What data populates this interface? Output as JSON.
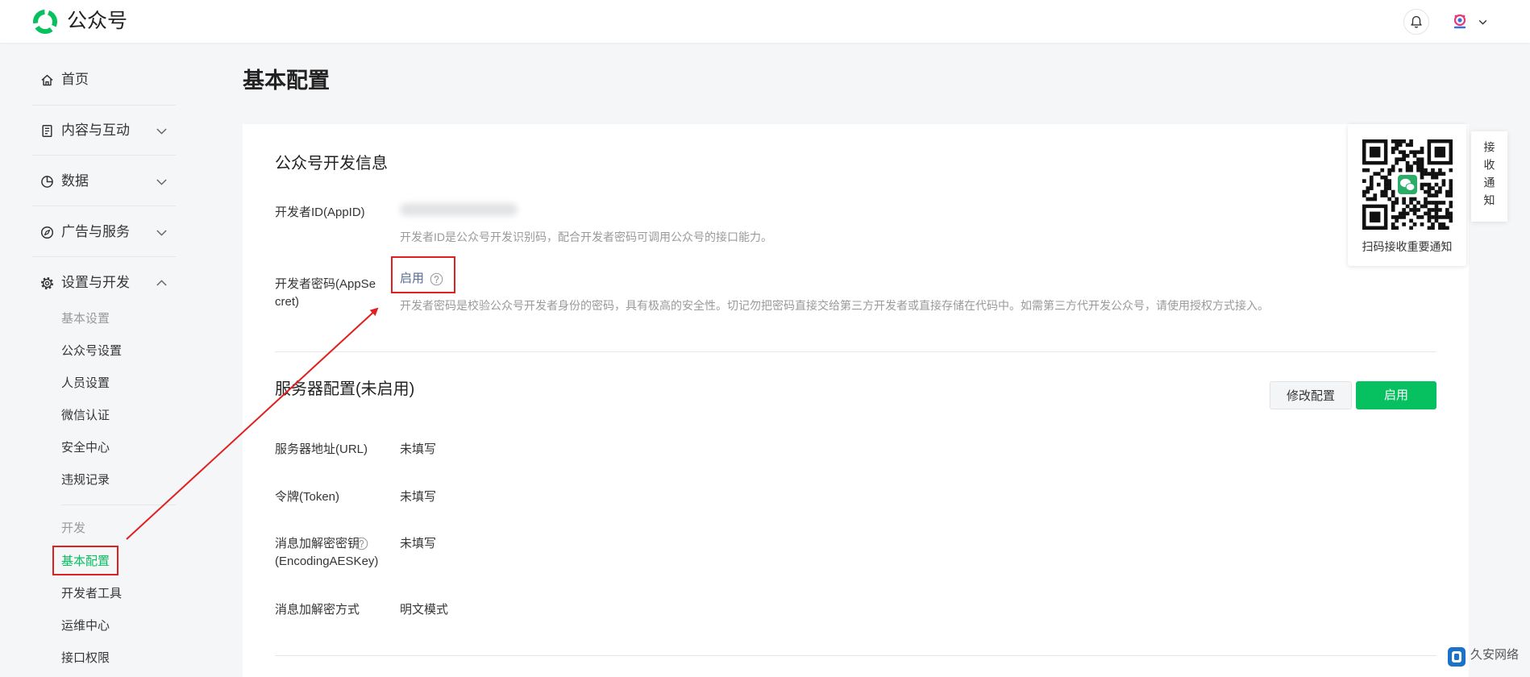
{
  "header": {
    "app_name": "公众号",
    "logo_icon": "wechat-official-account-logo-icon",
    "bell_icon": "bell-icon",
    "avatar_icon": "avatar",
    "menu_icon": "chevron-down-icon"
  },
  "sidebar": {
    "items": [
      {
        "label": "首页",
        "icon": "home-icon"
      },
      {
        "label": "内容与互动",
        "icon": "document-icon",
        "chevron": "down"
      },
      {
        "label": "数据",
        "icon": "pie-chart-icon",
        "chevron": "down"
      },
      {
        "label": "广告与服务",
        "icon": "compass-icon",
        "chevron": "down"
      },
      {
        "label": "设置与开发",
        "icon": "gear-icon",
        "chevron": "up"
      }
    ],
    "settings_group": {
      "basic_heading": "基本设置",
      "basic_items": [
        "公众号设置",
        "人员设置",
        "微信认证",
        "安全中心",
        "违规记录"
      ],
      "dev_heading": "开发",
      "dev_items": [
        "基本配置",
        "开发者工具",
        "运维中心",
        "接口权限"
      ],
      "active_item": "基本配置"
    }
  },
  "main": {
    "page_title": "基本配置",
    "dev_info": {
      "title": "公众号开发信息",
      "appid_label": "开发者ID(AppID)",
      "appid_desc": "开发者ID是公众号开发识别码，配合开发者密码可调用公众号的接口能力。",
      "secret_label": "开发者密码(AppSecret)",
      "secret_action": "启用",
      "help_icon": "question-circle-icon",
      "secret_desc": "开发者密码是校验公众号开发者身份的密码，具有极高的安全性。切记勿把密码直接交给第三方开发者或直接存储在代码中。如需第三方代开发公众号，请使用授权方式接入。"
    },
    "server_config": {
      "title": "服务器配置(未启用)",
      "modify_button": "修改配置",
      "enable_button": "启用",
      "fields": [
        {
          "label": "服务器地址(URL)",
          "value": "未填写"
        },
        {
          "label": "令牌(Token)",
          "value": "未填写"
        },
        {
          "label": "消息加解密密钥",
          "label_line2": "(EncodingAESKey)",
          "value": "未填写"
        },
        {
          "label": "消息加解密方式",
          "value": "明文模式"
        }
      ]
    }
  },
  "qr_panel": {
    "caption": "扫码接收重要通知",
    "icon": "qr-code"
  },
  "notify_tab": {
    "label": "接收通知"
  },
  "watermark": {
    "text": "久安网络"
  },
  "colors": {
    "accent": "#07c160",
    "link": "#576b95",
    "annotation": "#e02020",
    "page_background": "#f5f6f7"
  }
}
